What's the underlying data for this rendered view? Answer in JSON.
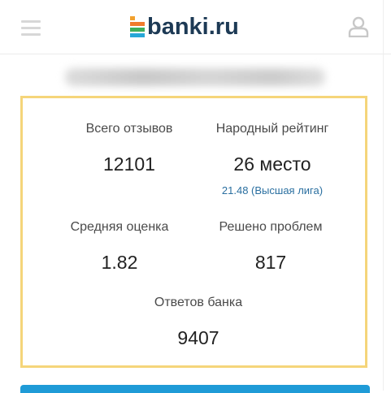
{
  "header": {
    "logo_text": "banki.ru",
    "menu_icon": "hamburger-menu-icon",
    "user_icon": "user-profile-icon"
  },
  "stats": {
    "total_reviews": {
      "label": "Всего отзывов",
      "value": "12101"
    },
    "people_rating": {
      "label": "Народный рейтинг",
      "value": "26 место",
      "sub": "21.48 (Высшая лига)"
    },
    "average_score": {
      "label": "Средняя оценка",
      "value": "1.82"
    },
    "problems_solved": {
      "label": "Решено проблем",
      "value": "817"
    },
    "bank_answers": {
      "label": "Ответов банка",
      "value": "9407"
    }
  },
  "colors": {
    "card_border": "#f5d57a",
    "brand_dark": "#1d3a55",
    "link": "#2a6fa0",
    "accent_bar": "#1f9bd7"
  }
}
